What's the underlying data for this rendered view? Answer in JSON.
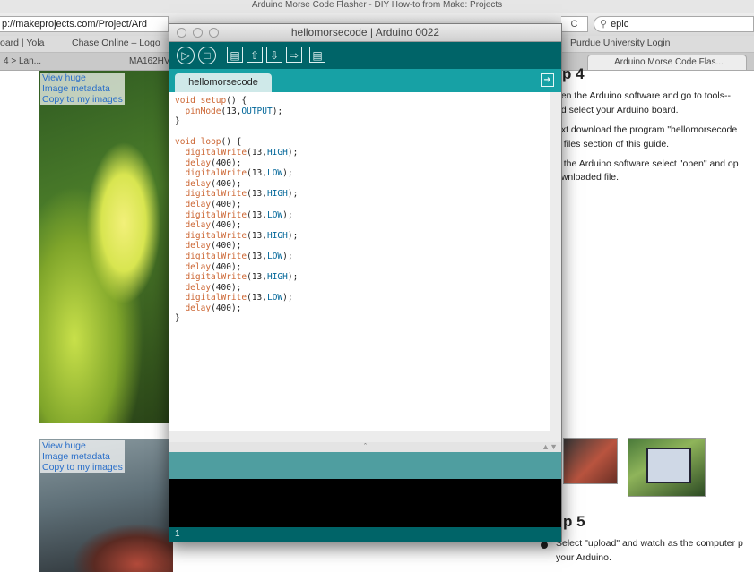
{
  "browser": {
    "window_title": "Arduino Morse Code Flasher - DIY How-to from Make: Projects",
    "url": "p://makeprojects.com/Project/Ard",
    "url_tail": "C",
    "search_value": "epic",
    "bookmarks": [
      "oard | Yola",
      "Chase Online – Logo",
      "Purdue University Login"
    ],
    "tabs": [
      "4 > Lan...",
      "MA162HV",
      "Arduino Morse Code Flas..."
    ]
  },
  "page": {
    "photo_links": [
      "View huge",
      "Image metadata",
      "Copy to my images"
    ],
    "step4_heading": "p 4",
    "step4_lines": [
      "pen the Arduino software and go to tools--",
      "nd select your Arduino board.",
      "ext download the program \"hellomorsecode",
      "e files section of this guide.",
      "n the Arduino software select \"open\" and op",
      "ownloaded file."
    ],
    "step5_heading": "p 5",
    "step5_lines": [
      "Select \"upload\" and watch as the computer p",
      "your Arduino."
    ]
  },
  "ide": {
    "title": "hellomorsecode | Arduino 0022",
    "tab_name": "hellomorsecode",
    "line_number": "1",
    "toolbar_icons": [
      "verify-icon",
      "stop-icon",
      "new-icon",
      "open-icon",
      "save-icon",
      "upload-icon",
      "serial-monitor-icon"
    ],
    "code": [
      "void setup() {",
      "  pinMode(13,OUTPUT);",
      "}",
      "",
      "void loop() {",
      "  digitalWrite(13,HIGH);",
      "  delay(400);",
      "  digitalWrite(13,LOW);",
      "  delay(400);",
      "  digitalWrite(13,HIGH);",
      "  delay(400);",
      "  digitalWrite(13,LOW);",
      "  delay(400);",
      "  digitalWrite(13,HIGH);",
      "  delay(400);",
      "  digitalWrite(13,LOW);",
      "  delay(400);",
      "  digitalWrite(13,HIGH);",
      "  delay(400);",
      "  digitalWrite(13,LOW);",
      "  delay(400);",
      "}"
    ],
    "colors": {
      "toolbar": "#006468",
      "tabbar": "#17a1a5",
      "status": "#4f9ea0",
      "console": "#000000"
    }
  }
}
